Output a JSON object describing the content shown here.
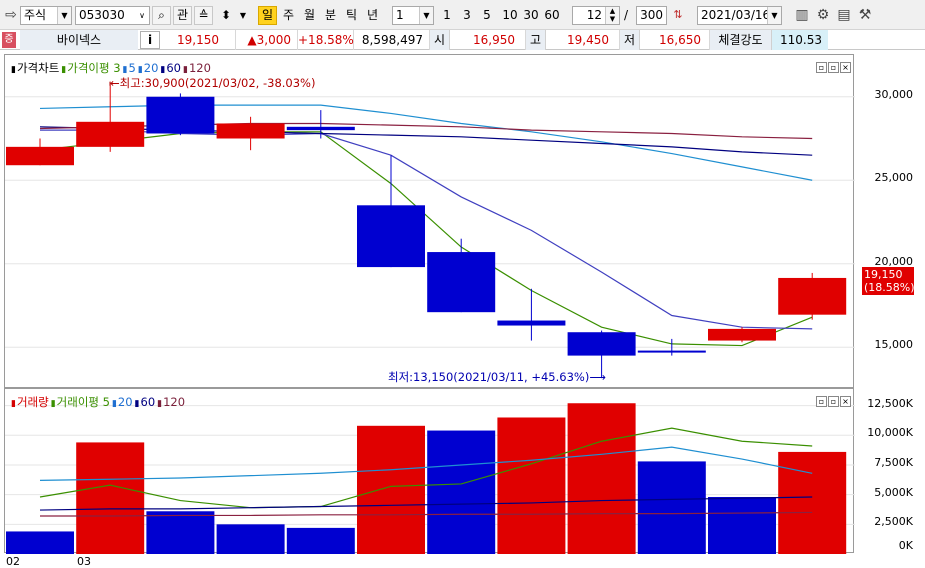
{
  "toolbar": {
    "market": "주식",
    "code": "053030",
    "btn_search": "⌕",
    "btn_watch": "관",
    "periods": [
      "일",
      "주",
      "월",
      "분",
      "틱",
      "년"
    ],
    "active_period": "일",
    "unit_value": "1",
    "quick_units": [
      "1",
      "3",
      "5",
      "10",
      "30",
      "60"
    ],
    "count_value": "12",
    "count_sep": "/",
    "count_max": "300",
    "date": "2021/03/16"
  },
  "quote": {
    "tag": "증",
    "name": "바이넥스",
    "info": "i",
    "price": "19,150",
    "change": "▲3,000",
    "change_pct": "+18.58%",
    "volume": "8,598,497",
    "open_label": "시",
    "open": "16,950",
    "high_label": "고",
    "high": "19,450",
    "low_label": "저",
    "low": "16,650",
    "strength_label": "체결강도",
    "strength": "110.53"
  },
  "price_panel": {
    "legend": [
      {
        "text": "가격차트",
        "color": "#000000"
      },
      {
        "text": "가격이평 3",
        "color": "#3a8f00"
      },
      {
        "text": "5",
        "color": "#1f6fd1"
      },
      {
        "text": "20",
        "color": "#1f6fd1"
      },
      {
        "text": "60",
        "color": "#000080"
      },
      {
        "text": "120",
        "color": "#7a1f3a"
      }
    ],
    "high_annotation": "←최고:30,900(2021/03/02, -38.03%)",
    "low_annotation": "최저:13,150(2021/03/11, +45.63%)⟶",
    "last_price": "19,150",
    "last_pct": "(18.58%)",
    "y_labels": [
      "30,000",
      "25,000",
      "20,000",
      "15,000"
    ]
  },
  "volume_panel": {
    "legend": [
      {
        "text": "거래량",
        "color": "#d40000"
      },
      {
        "text": "거래이평 5",
        "color": "#3a8f00"
      },
      {
        "text": "20",
        "color": "#1f6fd1"
      },
      {
        "text": "60",
        "color": "#000080"
      },
      {
        "text": "120",
        "color": "#7a1f3a"
      }
    ],
    "y_labels": [
      "12,500K",
      "10,000K",
      "7,500K",
      "5,000K",
      "2,500K",
      "0K"
    ]
  },
  "x_labels": [
    "02",
    "03"
  ],
  "colors": {
    "up": "#e00000",
    "down": "#0000d0"
  },
  "chart_data": [
    {
      "type": "candlestick",
      "ylim": [
        12500,
        32500
      ],
      "candles": [
        {
          "o": 25900,
          "h": 27500,
          "l": 25900,
          "c": 27000,
          "dir": "up"
        },
        {
          "o": 27000,
          "h": 30900,
          "l": 26700,
          "c": 28500,
          "dir": "up"
        },
        {
          "o": 30000,
          "h": 30200,
          "l": 27700,
          "c": 27800,
          "dir": "down"
        },
        {
          "o": 27500,
          "h": 28800,
          "l": 26800,
          "c": 28400,
          "dir": "up"
        },
        {
          "o": 28200,
          "h": 29200,
          "l": 27500,
          "c": 28000,
          "dir": "down"
        },
        {
          "o": 23500,
          "h": 26500,
          "l": 19800,
          "c": 19800,
          "dir": "down"
        },
        {
          "o": 20700,
          "h": 21500,
          "l": 17100,
          "c": 17100,
          "dir": "down"
        },
        {
          "o": 16600,
          "h": 18500,
          "l": 15400,
          "c": 16300,
          "dir": "down"
        },
        {
          "o": 15900,
          "h": 16000,
          "l": 13150,
          "c": 14500,
          "dir": "down"
        },
        {
          "o": 14800,
          "h": 15500,
          "l": 14500,
          "c": 14800,
          "dir": "down"
        },
        {
          "o": 15400,
          "h": 16200,
          "l": 15300,
          "c": 16100,
          "dir": "up"
        },
        {
          "o": 16950,
          "h": 19450,
          "l": 16650,
          "c": 19150,
          "dir": "up"
        }
      ],
      "ma": [
        {
          "name": "3",
          "color": "#3a8f00",
          "values": [
            26800,
            27300,
            27800,
            27900,
            27900,
            24800,
            21000,
            18400,
            16200,
            15200,
            15100,
            16800
          ]
        },
        {
          "name": "5",
          "color": "#4040c0",
          "values": [
            28000,
            28000,
            27800,
            27700,
            27800,
            26500,
            24000,
            22000,
            19500,
            16900,
            16200,
            16100
          ]
        },
        {
          "name": "20",
          "color": "#1f8fd1",
          "values": [
            29300,
            29400,
            29500,
            29500,
            29500,
            29000,
            28400,
            27900,
            27300,
            26600,
            25800,
            25000
          ]
        },
        {
          "name": "60",
          "color": "#000080",
          "values": [
            28200,
            28100,
            28000,
            27900,
            27800,
            27700,
            27600,
            27400,
            27200,
            27000,
            26700,
            26500
          ]
        },
        {
          "name": "120",
          "color": "#8a2040",
          "values": [
            28100,
            28200,
            28300,
            28400,
            28400,
            28300,
            28200,
            28000,
            27900,
            27800,
            27600,
            27500
          ]
        }
      ]
    },
    {
      "type": "bar",
      "ylim": [
        0,
        13900
      ],
      "values": [
        1900,
        9400,
        3600,
        2500,
        2200,
        10800,
        10400,
        11500,
        12700,
        7800,
        4800,
        8600
      ],
      "dirs": [
        "down",
        "up",
        "down",
        "down",
        "down",
        "up",
        "down",
        "up",
        "up",
        "down",
        "down",
        "up"
      ],
      "ma": [
        {
          "name": "5",
          "color": "#3a8f00",
          "values": [
            4800,
            5800,
            4500,
            3900,
            4000,
            5700,
            5900,
            7600,
            9500,
            10600,
            9500,
            9100
          ]
        },
        {
          "name": "20",
          "color": "#1f8fd1",
          "values": [
            6200,
            6300,
            6400,
            6600,
            6800,
            7100,
            7500,
            7900,
            8400,
            9000,
            8000,
            6800
          ]
        },
        {
          "name": "60",
          "color": "#000080",
          "values": [
            3700,
            3800,
            3800,
            3900,
            4000,
            4100,
            4200,
            4300,
            4500,
            4600,
            4700,
            4800
          ]
        },
        {
          "name": "120",
          "color": "#8a2040",
          "values": [
            3200,
            3200,
            3250,
            3250,
            3300,
            3300,
            3350,
            3350,
            3400,
            3400,
            3450,
            3500
          ]
        }
      ]
    }
  ]
}
